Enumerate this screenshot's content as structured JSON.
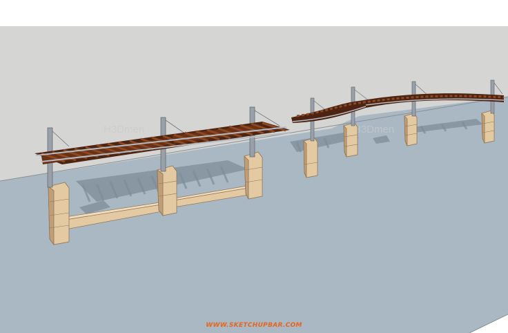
{
  "scene": {
    "watermark_text": "WWW.SKETCHUPBAR.COM",
    "colors": {
      "sky": "#ffffff",
      "wall": "#d5d5d3",
      "ground": "#a9b8c3",
      "shadow": "#7f8d97",
      "stone": "#e4caa3",
      "stone_dark": "#bf9f78",
      "wood": "#7a3a1c",
      "wood_dark": "#4d2312",
      "steel": "#9aa0a7",
      "watermark": "#e8641c"
    }
  }
}
